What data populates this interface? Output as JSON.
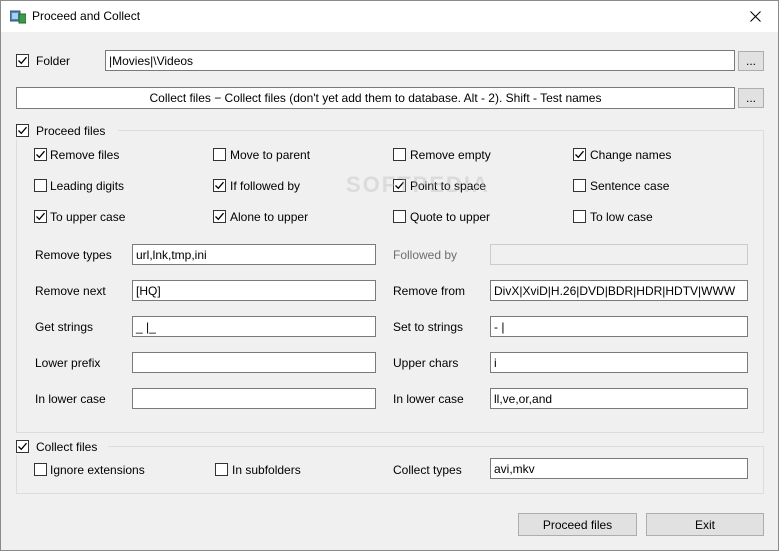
{
  "window": {
    "title": "Proceed and Collect",
    "close_glyph": "✕"
  },
  "folder": {
    "label": "Folder",
    "checked": true,
    "value": "|Movies|\\Videos",
    "browse_label": "..."
  },
  "collect_button": {
    "label": "Collect files − Collect files (don't yet add them to database. Alt - 2). Shift - Test names",
    "browse_label": "..."
  },
  "proceed": {
    "label": "Proceed files",
    "checked": true,
    "options": [
      {
        "label": "Remove files",
        "checked": true
      },
      {
        "label": "Move to parent",
        "checked": false
      },
      {
        "label": "Remove empty",
        "checked": false
      },
      {
        "label": "Change names",
        "checked": true
      },
      {
        "label": "Leading digits",
        "checked": false
      },
      {
        "label": "If followed by",
        "checked": true
      },
      {
        "label": "Point to space",
        "checked": true
      },
      {
        "label": "Sentence case",
        "checked": false
      },
      {
        "label": "To upper case",
        "checked": true
      },
      {
        "label": "Alone to upper",
        "checked": true
      },
      {
        "label": "Quote to upper",
        "checked": false
      },
      {
        "label": "To low case",
        "checked": false
      }
    ],
    "fields": {
      "remove_types": {
        "label": "Remove types",
        "value": "url,lnk,tmp,ini"
      },
      "followed_by": {
        "label": "Followed by",
        "value": ""
      },
      "remove_next": {
        "label": "Remove next",
        "value": "[HQ]"
      },
      "remove_from": {
        "label": "Remove from",
        "value": "DivX|XviD|H.26|DVD|BDR|HDR|HDTV|WWW"
      },
      "get_strings": {
        "label": "Get strings",
        "value": "_ |_"
      },
      "set_to_strings": {
        "label": "Set to strings",
        "value": " - |"
      },
      "lower_prefix": {
        "label": "Lower prefix",
        "value": ""
      },
      "upper_chars": {
        "label": "Upper chars",
        "value": "i"
      },
      "in_lower_case_left": {
        "label": "In lower case",
        "value": ""
      },
      "in_lower_case_right": {
        "label": "In lower case",
        "value": "ll,ve,or,and"
      }
    }
  },
  "collect": {
    "label": "Collect files",
    "checked": true,
    "ignore_extensions": {
      "label": "Ignore extensions",
      "checked": false
    },
    "in_subfolders": {
      "label": "In subfolders",
      "checked": false
    },
    "collect_types": {
      "label": "Collect types",
      "value": "avi,mkv"
    }
  },
  "footer": {
    "proceed_label": "Proceed files",
    "exit_label": "Exit"
  },
  "watermark": "SOFTPEDIA",
  "colors": {
    "window_bg": "#f0f0f0",
    "titlebar_bg": "#ffffff",
    "button_bg": "#e1e1e1",
    "border": "#7a7a7a"
  }
}
